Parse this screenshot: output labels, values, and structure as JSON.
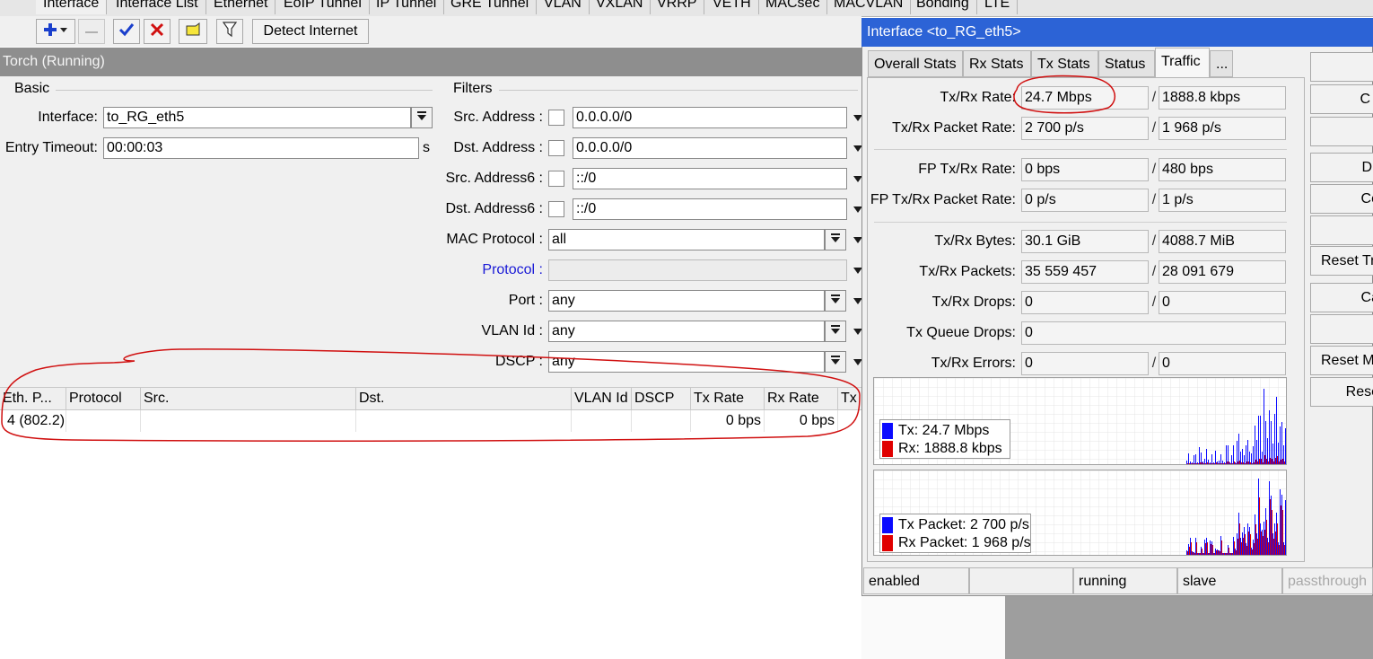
{
  "top_tabs": [
    "Interface",
    "Interface List",
    "Ethernet",
    "EoIP Tunnel",
    "IP Tunnel",
    "GRE Tunnel",
    "VLAN",
    "VXLAN",
    "VRRP",
    "VETH",
    "MACsec",
    "MACVLAN",
    "Bonding",
    "LTE"
  ],
  "toolbar": {
    "detect_label": "Detect Internet"
  },
  "torch": {
    "title": "Torch (Running)",
    "basic_label": "Basic",
    "filters_label": "Filters",
    "interface_label": "Interface:",
    "interface_value": "to_RG_eth5",
    "timeout_label": "Entry Timeout:",
    "timeout_value": "00:00:03",
    "timeout_unit": "s",
    "src_address_label": "Src. Address :",
    "src_address_value": "0.0.0.0/0",
    "dst_address_label": "Dst. Address :",
    "dst_address_value": "0.0.0.0/0",
    "src_address6_label": "Src. Address6 :",
    "src_address6_value": "::/0",
    "dst_address6_label": "Dst. Address6 :",
    "dst_address6_value": "::/0",
    "mac_protocol_label": "MAC Protocol :",
    "mac_protocol_value": "all",
    "protocol_label": "Protocol :",
    "port_label": "Port :",
    "port_value": "any",
    "vlan_label": "VLAN Id :",
    "vlan_value": "any",
    "dscp_label": "DSCP :",
    "dscp_value": "any"
  },
  "table": {
    "headers": [
      "Eth. P...",
      "Protocol",
      "Src.",
      "Dst.",
      "VLAN Id",
      "DSCP",
      "Tx Rate",
      "Rx Rate",
      "Tx"
    ],
    "rows": [
      [
        "4 (802.2)",
        "",
        "",
        "",
        "",
        "",
        "0 bps",
        "0 bps"
      ]
    ]
  },
  "iface": {
    "title": "Interface <to_RG_eth5>",
    "tabs": [
      "Overall Stats",
      "Rx Stats",
      "Tx Stats",
      "Status",
      "Traffic",
      "..."
    ],
    "slash": "/",
    "stats": [
      {
        "label": "Tx/Rx Rate:",
        "tx": "24.7 Mbps",
        "rx": "1888.8 kbps"
      },
      {
        "label": "Tx/Rx Packet Rate:",
        "tx": "2 700 p/s",
        "rx": "1 968 p/s"
      },
      {
        "label": "FP Tx/Rx Rate:",
        "tx": "0 bps",
        "rx": "480 bps"
      },
      {
        "label": "FP Tx/Rx Packet Rate:",
        "tx": "0 p/s",
        "rx": "1 p/s"
      },
      {
        "label": "Tx/Rx Bytes:",
        "tx": "30.1 GiB",
        "rx": "4088.7 MiB"
      },
      {
        "label": "Tx/Rx Packets:",
        "tx": "35 559 457",
        "rx": "28 091 679"
      },
      {
        "label": "Tx/Rx Drops:",
        "tx": "0",
        "rx": "0"
      },
      {
        "label": "Tx Queue Drops:",
        "tx": "0"
      },
      {
        "label": "Tx/Rx Errors:",
        "tx": "0",
        "rx": "0"
      }
    ],
    "graph_rate": {
      "tx_label": "Tx:  24.7 Mbps",
      "rx_label": "Rx:  1888.8 kbps"
    },
    "graph_packet": {
      "tx_label": "Tx Packet:  2 700 p/s",
      "rx_label": "Rx Packet:  1 968 p/s"
    },
    "status": [
      "enabled",
      "",
      "running",
      "slave",
      "passthrough"
    ],
    "side_buttons": [
      "",
      "C",
      "",
      "D",
      "Co",
      "",
      "Reset Tr",
      "Ca",
      "",
      "Reset M",
      "Rese"
    ]
  },
  "colors": {
    "tx": "#0a0aff",
    "rx": "#e00000",
    "title_bar": "#2c63d6",
    "annotation": "#d01010"
  }
}
